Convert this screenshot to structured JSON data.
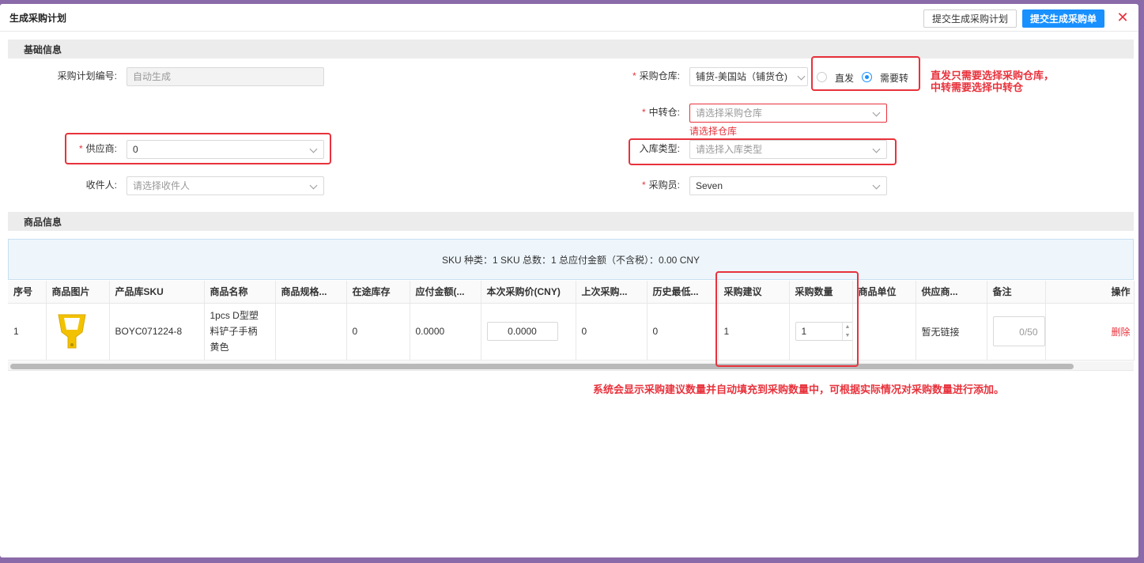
{
  "dialog": {
    "title": "生成采购计划",
    "btn_plan": "提交生成采购计划",
    "btn_order": "提交生成采购单",
    "close": "✕"
  },
  "basic": {
    "section_title": "基础信息",
    "plan_no_label": "采购计划编号:",
    "plan_no_value": "自动生成",
    "supplier_label": "供应商:",
    "supplier_value": "0",
    "receiver_label": "收件人:",
    "receiver_placeholder": "请选择收件人",
    "warehouse_label": "采购仓库:",
    "warehouse_value": "铺货-美国站（铺货仓)",
    "transit_label": "中转仓:",
    "transit_placeholder": "请选择采购仓库",
    "transit_error": "请选择仓库",
    "inbound_label": "入库类型:",
    "inbound_placeholder": "请选择入库类型",
    "buyer_label": "采购员:",
    "buyer_value": "Seven",
    "radio_direct": "直发",
    "radio_transit": "需要转",
    "required_mark": "*"
  },
  "goods": {
    "section_title": "商品信息",
    "summary": "SKU 种类：1 SKU 总数：1 总应付金额（不含税）：0.00 CNY",
    "columns": [
      "序号",
      "商品图片",
      "产品库SKU",
      "商品名称",
      "商品规格...",
      "在途库存",
      "应付金额(...",
      "本次采购价(CNY)",
      "上次采购...",
      "历史最低...",
      "采购建议",
      "采购数量",
      "商品单位",
      "供应商...",
      "备注",
      "操作"
    ],
    "row": {
      "index": "1",
      "sku": "BOYC071224-8",
      "name": "1pcs D型塑料铲子手柄黄色",
      "spec": "",
      "in_transit": "0",
      "payable": "0.0000",
      "price": "0.0000",
      "last_price": "0",
      "lowest_price": "0",
      "suggestion": "1",
      "quantity": "1",
      "unit": "",
      "supplier_link": "暂无链接",
      "remark": "0/50",
      "action": "删除"
    }
  },
  "annotations": {
    "note_radio_line1": "直发只需要选择采购仓库，",
    "note_radio_line2": "中转需要选择中转仓",
    "note_quantity": "系统会显示采购建议数量并自动填充到采购数量中，可根据实际情况对采购数量进行添加。"
  },
  "colors": {
    "primary": "#1890ff",
    "danger": "#e8323c",
    "product_yellow": "#f2c200"
  }
}
